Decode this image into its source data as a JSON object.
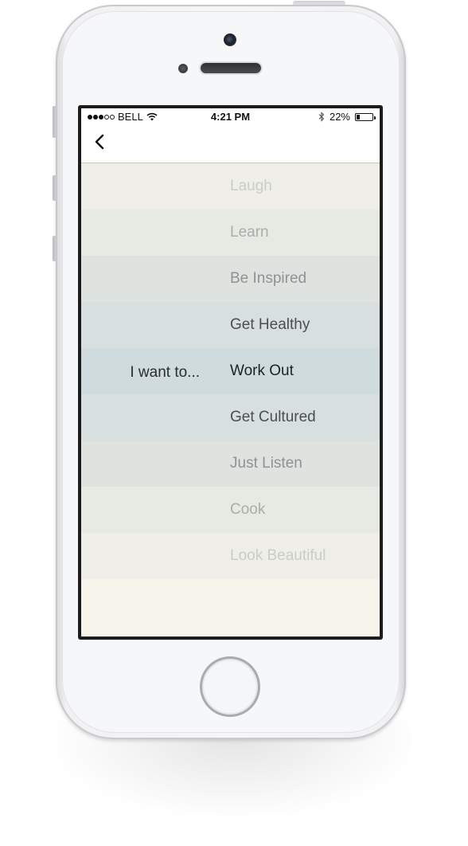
{
  "status_bar": {
    "signal_total": 5,
    "signal_bars": 3,
    "carrier": "BELL",
    "time": "4:21 PM",
    "battery_text": "22%",
    "battery_level": 0.22
  },
  "nav": {
    "back_icon": "chevron-left-icon"
  },
  "picker": {
    "prompt": "I want to...",
    "selected_index": 4,
    "options": [
      {
        "label": "Laugh",
        "bg": "#efeee8",
        "color": "#c9ccc9"
      },
      {
        "label": "Learn",
        "bg": "#e7e9e3",
        "color": "#a9adab"
      },
      {
        "label": "Be Inspired",
        "bg": "#dfe3e0",
        "color": "#8d9294"
      },
      {
        "label": "Get Healthy",
        "bg": "#d8dfdf",
        "color": "#4a4f52"
      },
      {
        "label": "Work Out",
        "bg": "#cfdbdc",
        "color": "#1f2224"
      },
      {
        "label": "Get Cultured",
        "bg": "#d8dfdf",
        "color": "#4a4f52"
      },
      {
        "label": "Just Listen",
        "bg": "#dfe3e0",
        "color": "#8d9294"
      },
      {
        "label": "Cook",
        "bg": "#e7e9e3",
        "color": "#a9adab"
      },
      {
        "label": "Look Beautiful",
        "bg": "#efeee8",
        "color": "#c9ccc9"
      }
    ]
  },
  "colors": {
    "background": "#f7f4ec",
    "phone_body": "#f6f7f9",
    "text_dark": "#1f2224"
  }
}
